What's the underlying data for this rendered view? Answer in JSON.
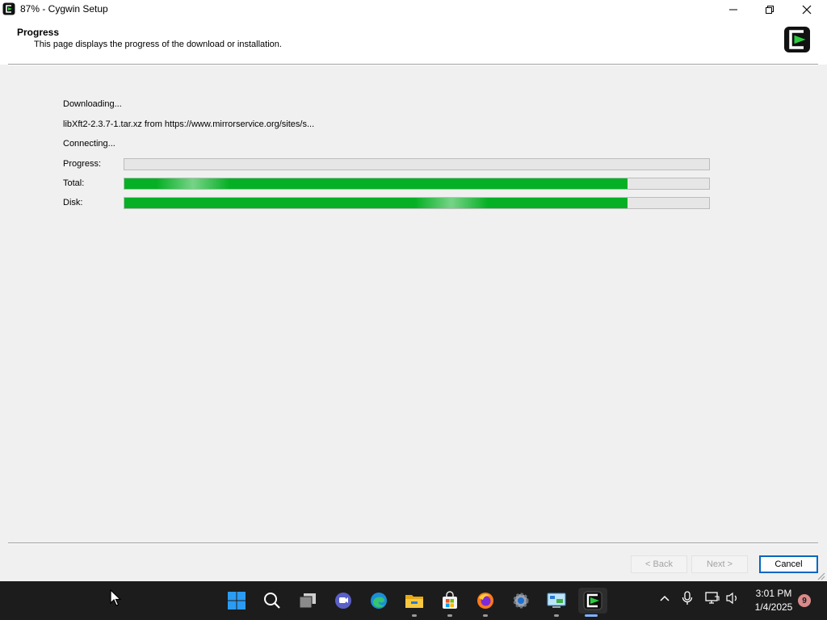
{
  "window": {
    "title": "87% - Cygwin Setup"
  },
  "header": {
    "heading": "Progress",
    "description": "This page displays the progress of the download or installation."
  },
  "status": {
    "line1": "Downloading...",
    "line2": "libXft2-2.3.7-1.tar.xz from https://www.mirrorservice.org/sites/s...",
    "line3": "Connecting..."
  },
  "bars": {
    "progress": {
      "label": "Progress:",
      "fraction": 0.0
    },
    "total": {
      "label": "Total:",
      "fraction": 0.86
    },
    "disk": {
      "label": "Disk:",
      "fraction": 0.86
    }
  },
  "buttons": {
    "back": "< Back",
    "next": "Next >",
    "cancel": "Cancel"
  },
  "taskbar": {
    "apps": [
      "start-icon",
      "search-icon",
      "task-view-icon",
      "teams-chat-icon",
      "edge-icon",
      "file-explorer-icon",
      "microsoft-store-icon",
      "firefox-icon",
      "settings-icon",
      "control-panel-icon",
      "cygwin-icon"
    ],
    "time": "3:01 PM",
    "date": "1/4/2025",
    "notification_count": "9"
  },
  "colors": {
    "progress_fill": "#06b025",
    "accent": "#0067c0",
    "taskbar": "#1c1c1c"
  }
}
